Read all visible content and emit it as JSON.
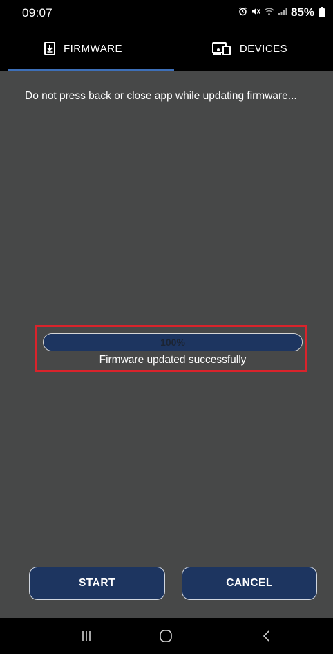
{
  "status_bar": {
    "time": "09:07",
    "battery_percent": "85%",
    "icons": [
      "alarm-icon",
      "mute-icon",
      "wifi-icon",
      "signal-icon",
      "battery-icon"
    ]
  },
  "tabs": [
    {
      "label": "FIRMWARE",
      "icon": "download-device-icon",
      "active": true
    },
    {
      "label": "DEVICES",
      "icon": "devices-icon",
      "active": false
    }
  ],
  "message": "Do not press back or close app while updating firmware...",
  "progress": {
    "value": 100,
    "label": "100%",
    "status": "Firmware updated successfully"
  },
  "actions": {
    "start_label": "START",
    "cancel_label": "CANCEL"
  },
  "nav": [
    "recents-icon",
    "home-icon",
    "back-icon"
  ],
  "colors": {
    "background": "#474848",
    "bars": "#000000",
    "accent": "#3d6fb8",
    "button": "#1d3560",
    "highlight": "#d9232b"
  }
}
